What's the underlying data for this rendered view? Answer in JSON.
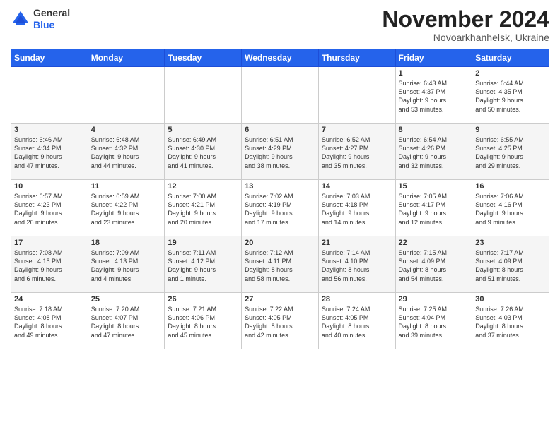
{
  "logo": {
    "general": "General",
    "blue": "Blue"
  },
  "title": "November 2024",
  "location": "Novoarkhanhelsk, Ukraine",
  "days_header": [
    "Sunday",
    "Monday",
    "Tuesday",
    "Wednesday",
    "Thursday",
    "Friday",
    "Saturday"
  ],
  "weeks": [
    [
      {
        "day": "",
        "info": ""
      },
      {
        "day": "",
        "info": ""
      },
      {
        "day": "",
        "info": ""
      },
      {
        "day": "",
        "info": ""
      },
      {
        "day": "",
        "info": ""
      },
      {
        "day": "1",
        "info": "Sunrise: 6:43 AM\nSunset: 4:37 PM\nDaylight: 9 hours\nand 53 minutes."
      },
      {
        "day": "2",
        "info": "Sunrise: 6:44 AM\nSunset: 4:35 PM\nDaylight: 9 hours\nand 50 minutes."
      }
    ],
    [
      {
        "day": "3",
        "info": "Sunrise: 6:46 AM\nSunset: 4:34 PM\nDaylight: 9 hours\nand 47 minutes."
      },
      {
        "day": "4",
        "info": "Sunrise: 6:48 AM\nSunset: 4:32 PM\nDaylight: 9 hours\nand 44 minutes."
      },
      {
        "day": "5",
        "info": "Sunrise: 6:49 AM\nSunset: 4:30 PM\nDaylight: 9 hours\nand 41 minutes."
      },
      {
        "day": "6",
        "info": "Sunrise: 6:51 AM\nSunset: 4:29 PM\nDaylight: 9 hours\nand 38 minutes."
      },
      {
        "day": "7",
        "info": "Sunrise: 6:52 AM\nSunset: 4:27 PM\nDaylight: 9 hours\nand 35 minutes."
      },
      {
        "day": "8",
        "info": "Sunrise: 6:54 AM\nSunset: 4:26 PM\nDaylight: 9 hours\nand 32 minutes."
      },
      {
        "day": "9",
        "info": "Sunrise: 6:55 AM\nSunset: 4:25 PM\nDaylight: 9 hours\nand 29 minutes."
      }
    ],
    [
      {
        "day": "10",
        "info": "Sunrise: 6:57 AM\nSunset: 4:23 PM\nDaylight: 9 hours\nand 26 minutes."
      },
      {
        "day": "11",
        "info": "Sunrise: 6:59 AM\nSunset: 4:22 PM\nDaylight: 9 hours\nand 23 minutes."
      },
      {
        "day": "12",
        "info": "Sunrise: 7:00 AM\nSunset: 4:21 PM\nDaylight: 9 hours\nand 20 minutes."
      },
      {
        "day": "13",
        "info": "Sunrise: 7:02 AM\nSunset: 4:19 PM\nDaylight: 9 hours\nand 17 minutes."
      },
      {
        "day": "14",
        "info": "Sunrise: 7:03 AM\nSunset: 4:18 PM\nDaylight: 9 hours\nand 14 minutes."
      },
      {
        "day": "15",
        "info": "Sunrise: 7:05 AM\nSunset: 4:17 PM\nDaylight: 9 hours\nand 12 minutes."
      },
      {
        "day": "16",
        "info": "Sunrise: 7:06 AM\nSunset: 4:16 PM\nDaylight: 9 hours\nand 9 minutes."
      }
    ],
    [
      {
        "day": "17",
        "info": "Sunrise: 7:08 AM\nSunset: 4:15 PM\nDaylight: 9 hours\nand 6 minutes."
      },
      {
        "day": "18",
        "info": "Sunrise: 7:09 AM\nSunset: 4:13 PM\nDaylight: 9 hours\nand 4 minutes."
      },
      {
        "day": "19",
        "info": "Sunrise: 7:11 AM\nSunset: 4:12 PM\nDaylight: 9 hours\nand 1 minute."
      },
      {
        "day": "20",
        "info": "Sunrise: 7:12 AM\nSunset: 4:11 PM\nDaylight: 8 hours\nand 58 minutes."
      },
      {
        "day": "21",
        "info": "Sunrise: 7:14 AM\nSunset: 4:10 PM\nDaylight: 8 hours\nand 56 minutes."
      },
      {
        "day": "22",
        "info": "Sunrise: 7:15 AM\nSunset: 4:09 PM\nDaylight: 8 hours\nand 54 minutes."
      },
      {
        "day": "23",
        "info": "Sunrise: 7:17 AM\nSunset: 4:09 PM\nDaylight: 8 hours\nand 51 minutes."
      }
    ],
    [
      {
        "day": "24",
        "info": "Sunrise: 7:18 AM\nSunset: 4:08 PM\nDaylight: 8 hours\nand 49 minutes."
      },
      {
        "day": "25",
        "info": "Sunrise: 7:20 AM\nSunset: 4:07 PM\nDaylight: 8 hours\nand 47 minutes."
      },
      {
        "day": "26",
        "info": "Sunrise: 7:21 AM\nSunset: 4:06 PM\nDaylight: 8 hours\nand 45 minutes."
      },
      {
        "day": "27",
        "info": "Sunrise: 7:22 AM\nSunset: 4:05 PM\nDaylight: 8 hours\nand 42 minutes."
      },
      {
        "day": "28",
        "info": "Sunrise: 7:24 AM\nSunset: 4:05 PM\nDaylight: 8 hours\nand 40 minutes."
      },
      {
        "day": "29",
        "info": "Sunrise: 7:25 AM\nSunset: 4:04 PM\nDaylight: 8 hours\nand 39 minutes."
      },
      {
        "day": "30",
        "info": "Sunrise: 7:26 AM\nSunset: 4:03 PM\nDaylight: 8 hours\nand 37 minutes."
      }
    ]
  ]
}
